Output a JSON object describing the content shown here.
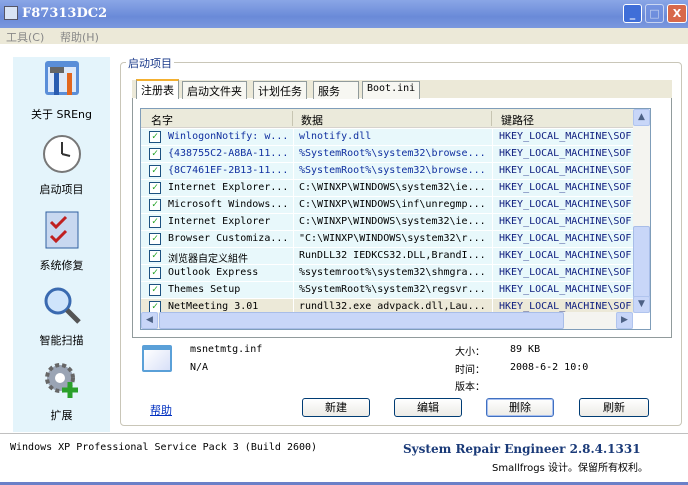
{
  "window": {
    "title": "F87313DC2"
  },
  "menu": [
    "工具(C)",
    "帮助(H)"
  ],
  "sidebar": [
    {
      "label": "关于 SREng",
      "icon": "tools-icon"
    },
    {
      "label": "启动项目",
      "icon": "clock-icon"
    },
    {
      "label": "系统修复",
      "icon": "checklist-icon"
    },
    {
      "label": "智能扫描",
      "icon": "magnifier-icon"
    },
    {
      "label": "扩展",
      "icon": "gear-plus-icon"
    }
  ],
  "group_title": "启动项目",
  "tabs": [
    "注册表",
    "启动文件夹",
    "计划任务",
    "服务",
    "Boot.ini"
  ],
  "table": {
    "columns": [
      "名字",
      "数据",
      "键路径"
    ],
    "rows": [
      {
        "name": "WinlogonNotify: w...",
        "data": "wlnotify.dll",
        "path": "HKEY_LOCAL_MACHINE\\SOF",
        "checked": true
      },
      {
        "name": "{438755C2-A8BA-11...",
        "data": "%SystemRoot%\\system32\\browse...",
        "path": "HKEY_LOCAL_MACHINE\\SOF",
        "checked": true
      },
      {
        "name": "{8C7461EF-2B13-11...",
        "data": "%SystemRoot%\\system32\\browse...",
        "path": "HKEY_LOCAL_MACHINE\\SOF",
        "checked": true
      },
      {
        "name": "Internet Explorer...",
        "data": "C:\\WINXP\\WINDOWS\\system32\\ie...",
        "path": "HKEY_LOCAL_MACHINE\\SOF",
        "checked": true
      },
      {
        "name": "Microsoft Windows...",
        "data": "C:\\WINXP\\WINDOWS\\inf\\unregmp...",
        "path": "HKEY_LOCAL_MACHINE\\SOF",
        "checked": true
      },
      {
        "name": "Internet Explorer",
        "data": "C:\\WINXP\\WINDOWS\\system32\\ie...",
        "path": "HKEY_LOCAL_MACHINE\\SOF",
        "checked": true
      },
      {
        "name": "Browser Customiza...",
        "data": "\"C:\\WINXP\\WINDOWS\\system32\\r...",
        "path": "HKEY_LOCAL_MACHINE\\SOF",
        "checked": true
      },
      {
        "name": "浏览器自定义組件",
        "data": "RunDLL32 IEDKCS32.DLL,BrandI...",
        "path": "HKEY_LOCAL_MACHINE\\SOF",
        "checked": true
      },
      {
        "name": "Outlook Express",
        "data": "%systemroot%\\system32\\shmgra...",
        "path": "HKEY_LOCAL_MACHINE\\SOF",
        "checked": true
      },
      {
        "name": "Themes Setup",
        "data": "%SystemRoot%\\system32\\regsvr...",
        "path": "HKEY_LOCAL_MACHINE\\SOF",
        "checked": true
      },
      {
        "name": "NetMeeting 3.01",
        "data": "rundll32.exe advpack.dll,Lau...",
        "path": "HKEY_LOCAL_MACHINE\\SOF",
        "checked": true
      }
    ]
  },
  "details": {
    "file": "msnetmtg.inf",
    "company": "N/A",
    "size_label": "大小：",
    "size": "89 KB",
    "time_label": "时间：",
    "time": "2008-6-2 10:0",
    "version_label": "版本：",
    "version": ""
  },
  "buttons": {
    "help": "帮助",
    "new": "新建",
    "edit": "编辑",
    "delete": "删除",
    "refresh": "刷新"
  },
  "status": {
    "os": "Windows XP Professional Service Pack 3 (Build 2600)",
    "app": "System Repair Engineer 2.8.4.1331",
    "copyright": "Smallfrogs 设计。保留所有权利。"
  }
}
